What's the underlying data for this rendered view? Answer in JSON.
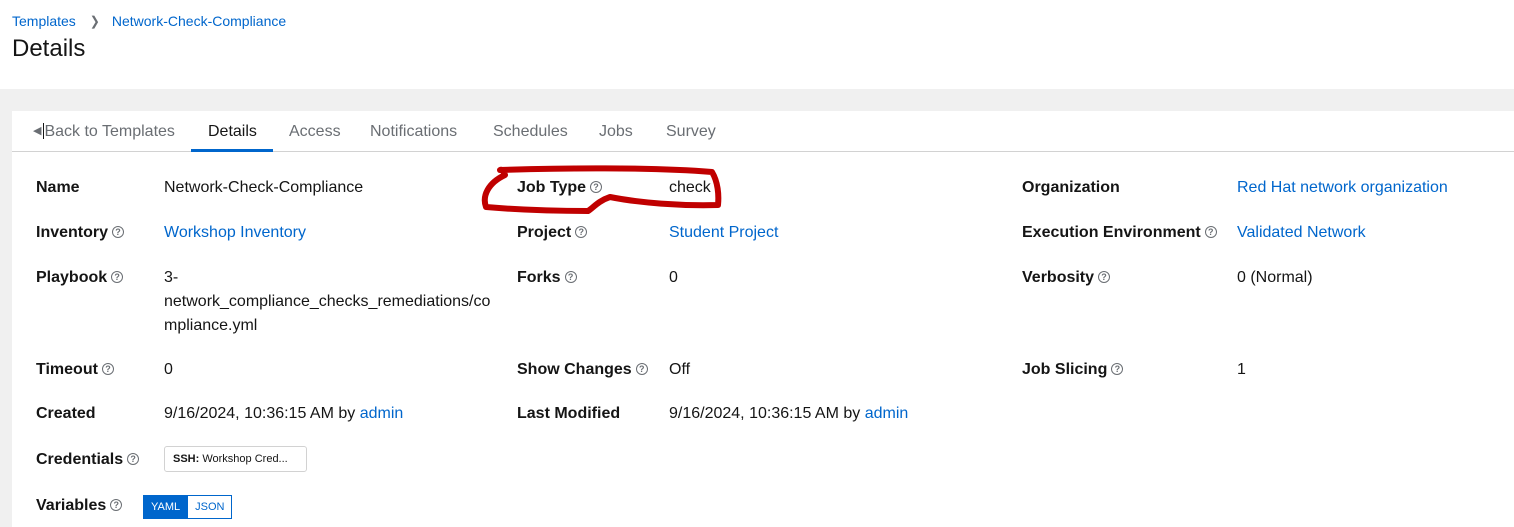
{
  "breadcrumb": {
    "root": "Templates",
    "current": "Network-Check-Compliance"
  },
  "page_title": "Details",
  "tabs": {
    "back": "Back to Templates",
    "items": [
      "Details",
      "Access",
      "Notifications",
      "Schedules",
      "Jobs",
      "Survey"
    ],
    "active": "Details"
  },
  "fields": {
    "name": {
      "label": "Name",
      "value": "Network-Check-Compliance"
    },
    "job_type": {
      "label": "Job Type",
      "value": "check"
    },
    "organization": {
      "label": "Organization",
      "value": "Red Hat network organization"
    },
    "inventory": {
      "label": "Inventory",
      "value": "Workshop Inventory"
    },
    "project": {
      "label": "Project",
      "value": "Student Project"
    },
    "execution_environment": {
      "label": "Execution Environment",
      "value": "Validated Network"
    },
    "playbook": {
      "label": "Playbook",
      "line1": "3-",
      "line2": "network_compliance_checks_remediations/co",
      "line3": "mpliance.yml"
    },
    "forks": {
      "label": "Forks",
      "value": "0"
    },
    "verbosity": {
      "label": "Verbosity",
      "value": "0 (Normal)"
    },
    "timeout": {
      "label": "Timeout",
      "value": "0"
    },
    "show_changes": {
      "label": "Show Changes",
      "value": "Off"
    },
    "job_slicing": {
      "label": "Job Slicing",
      "value": "1"
    },
    "created": {
      "label": "Created",
      "value": "9/16/2024, 10:36:15 AM by",
      "user": "admin"
    },
    "last_modified": {
      "label": "Last Modified",
      "value": "9/16/2024, 10:36:15 AM by",
      "user": "admin"
    },
    "credentials": {
      "label": "Credentials",
      "chip_type": "SSH:",
      "chip_value": "Workshop Cred..."
    },
    "variables": {
      "label": "Variables",
      "yaml": "YAML",
      "json": "JSON"
    }
  },
  "help_glyph": "?",
  "annotation_color": "#c00000"
}
